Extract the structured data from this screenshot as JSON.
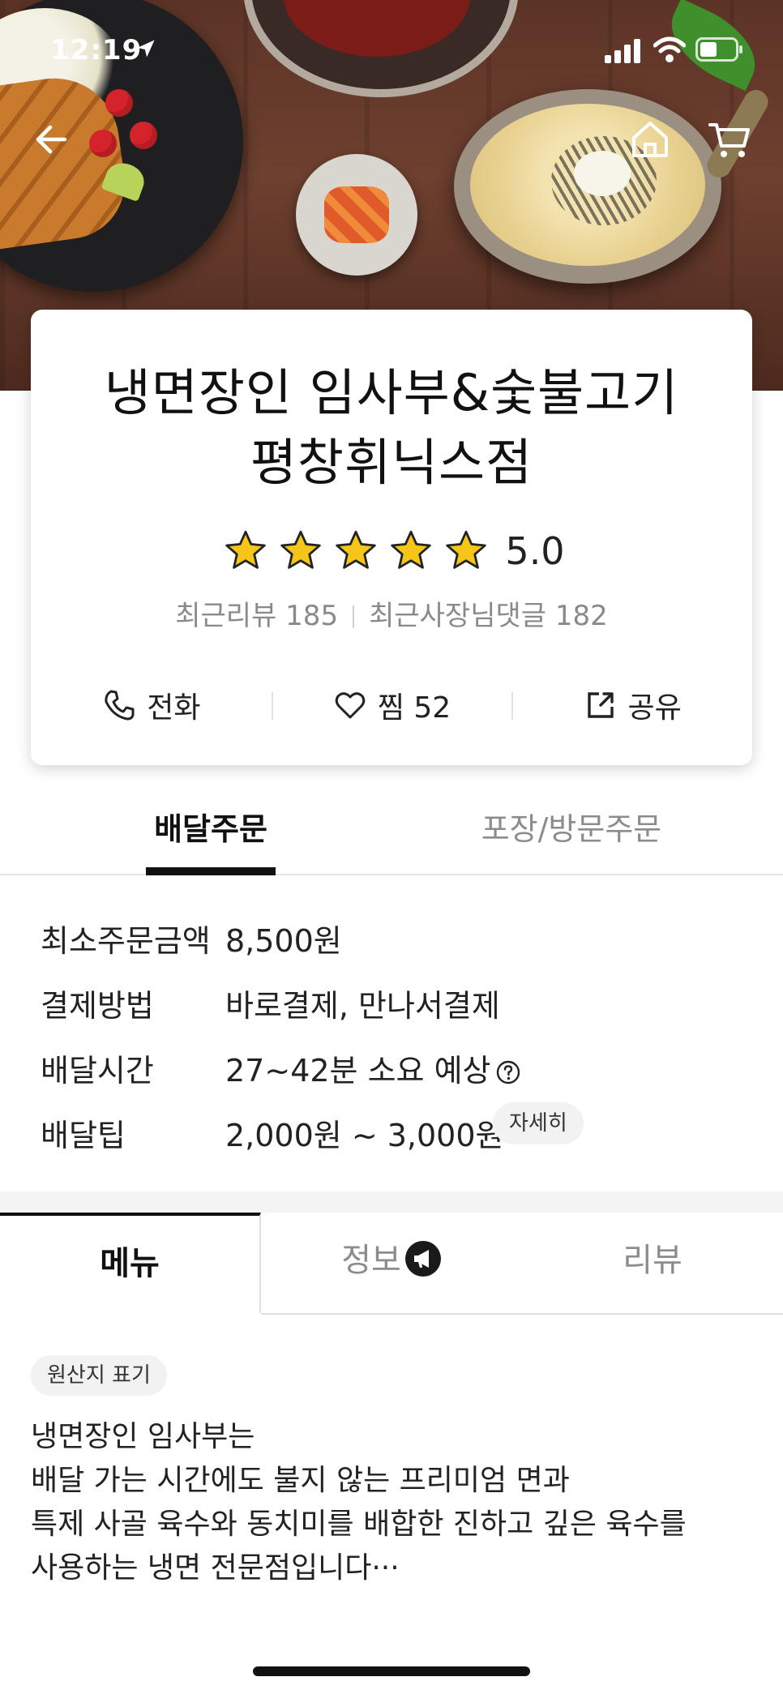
{
  "status_bar": {
    "time": "12:19"
  },
  "store": {
    "name_line1": "냉면장인 임사부&숯불고기",
    "name_line2": "평창휘닉스점",
    "rating": "5.0",
    "recent_reviews": "최근리뷰 185",
    "recent_owner_comments": "최근사장님댓글 182"
  },
  "actions": {
    "call": "전화",
    "like": "찜 52",
    "share": "공유"
  },
  "order_tabs": {
    "delivery": "배달주문",
    "pickup": "포장/방문주문"
  },
  "info": {
    "min_order_label": "최소주문금액",
    "min_order_value": "8,500원",
    "payment_label": "결제방법",
    "payment_value": "바로결제, 만나서결제",
    "time_label": "배달시간",
    "time_value": "27~42분 소요 예상",
    "tip_label": "배달팁",
    "tip_value": "2,000원 ~ 3,000원",
    "detail_button": "자세히"
  },
  "menu_tabs": {
    "menu": "메뉴",
    "info": "정보",
    "reviews": "리뷰"
  },
  "origin_chip": "원산지 표기",
  "description": [
    "냉면장인 임사부는",
    "배달 가는 시간에도 불지 않는 프리미엄 면과",
    "특제 사골 육수와 동치미를 배합한 진하고 깊은 육수를",
    "사용하는 냉면 전문점입니다···"
  ],
  "colors": {
    "star": "#f5c518",
    "text": "#111111",
    "muted": "#8c8c8c",
    "chip_bg": "#f2f2f2"
  }
}
